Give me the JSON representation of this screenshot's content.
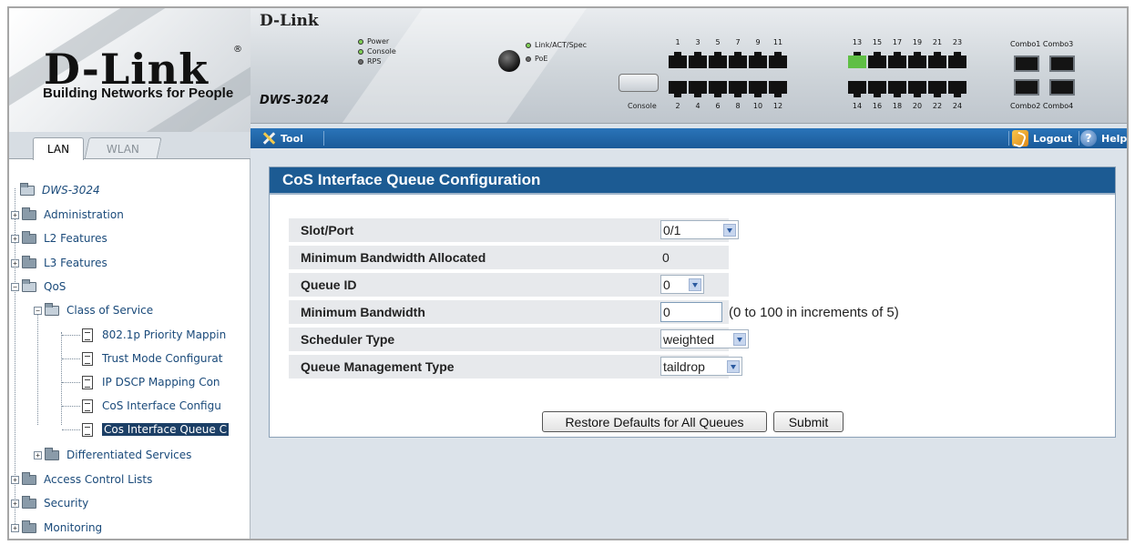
{
  "logo": {
    "title": "D-Link",
    "registered": "®",
    "tagline": "Building Networks for People"
  },
  "device": {
    "brand": "D-Link",
    "model": "DWS-3024",
    "leds": [
      "Power",
      "Console",
      "RPS",
      "Link/ACT/Spec",
      "PoE"
    ],
    "console_label": "Console",
    "top_ports_a": [
      "1",
      "3",
      "5",
      "7",
      "9",
      "11"
    ],
    "top_ports_b": [
      "13",
      "15",
      "17",
      "19",
      "21",
      "23"
    ],
    "bottom_ports_a": [
      "2",
      "4",
      "6",
      "8",
      "10",
      "12"
    ],
    "bottom_ports_b": [
      "14",
      "16",
      "18",
      "20",
      "22",
      "24"
    ],
    "combo_top": "Combo1 Combo3",
    "combo_bottom": "Combo2 Combo4"
  },
  "tabs": {
    "lan": "LAN",
    "wlan": "WLAN"
  },
  "tree": {
    "root": "DWS-3024",
    "administration": "Administration",
    "l2": "L2 Features",
    "l3": "L3 Features",
    "qos": "QoS",
    "cos": "Class of Service",
    "cos_items": [
      "802.1p Priority Mappin",
      "Trust Mode Configurat",
      "IP DSCP Mapping Con",
      "CoS Interface Configu",
      "Cos Interface Queue C"
    ],
    "diffserv": "Differentiated Services",
    "acl": "Access Control Lists",
    "security": "Security",
    "monitoring": "Monitoring"
  },
  "toolbar": {
    "tool": "Tool",
    "logout": "Logout",
    "help": "Help"
  },
  "panel": {
    "title": "CoS Interface Queue Configuration",
    "fields": {
      "slot_port": {
        "label": "Slot/Port",
        "value": "0/1"
      },
      "min_bw_alloc": {
        "label": "Minimum Bandwidth Allocated",
        "value": "0"
      },
      "queue_id": {
        "label": "Queue ID",
        "value": "0"
      },
      "min_bw": {
        "label": "Minimum Bandwidth",
        "value": "0",
        "hint": "(0 to 100 in increments of 5)"
      },
      "scheduler": {
        "label": "Scheduler Type",
        "value": "weighted"
      },
      "queue_mgmt": {
        "label": "Queue Management Type",
        "value": "taildrop"
      }
    },
    "buttons": {
      "restore": "Restore Defaults for All Queues",
      "submit": "Submit"
    }
  }
}
